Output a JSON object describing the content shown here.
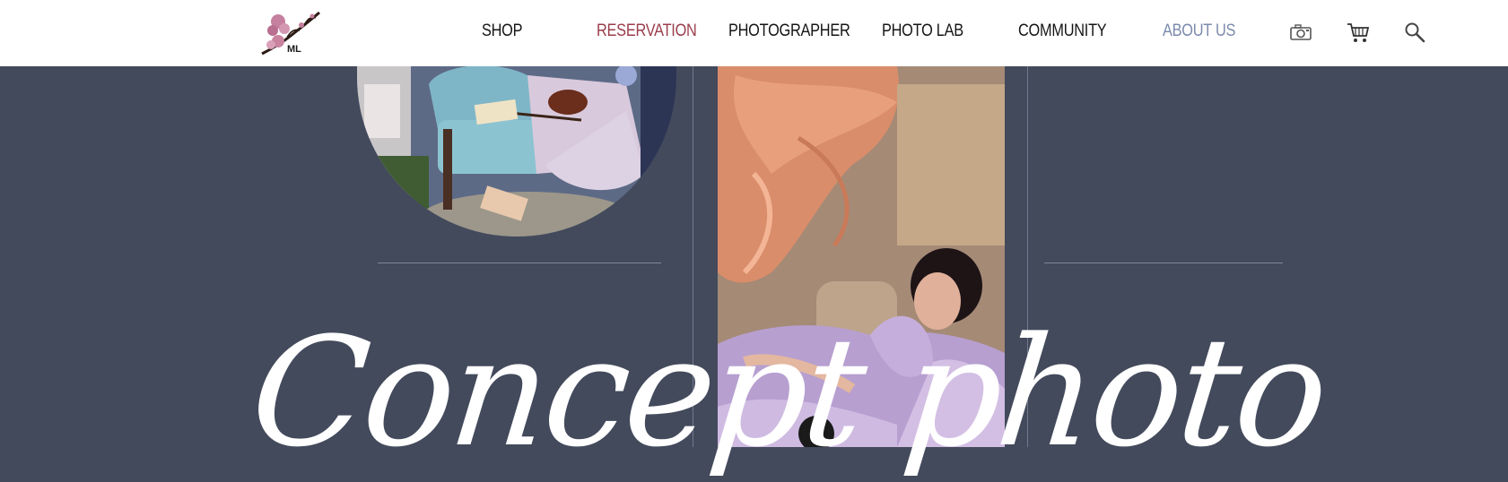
{
  "header": {
    "logo": {
      "name": "cherry-blossom-logo",
      "text": "ML"
    },
    "nav": [
      {
        "id": "shop",
        "label": "SHOP"
      },
      {
        "id": "reservation",
        "label": "RESERVATION"
      },
      {
        "id": "photographer",
        "label": "PHOTOGRAPHER"
      },
      {
        "id": "photo-lab",
        "label": "PHOTO LAB"
      },
      {
        "id": "community",
        "label": "COMMUNITY"
      },
      {
        "id": "about-us",
        "label": "ABOUT US"
      }
    ],
    "icons": [
      "camera-icon",
      "cart-icon",
      "search-icon"
    ]
  },
  "hero": {
    "title": "Concept photo"
  },
  "colors": {
    "background": "#434a5c",
    "header": "#ffffff",
    "nav_text": "#151515",
    "nav_active": "#9a3d4c",
    "nav_muted": "#7b8aac",
    "title": "#ffffff"
  }
}
